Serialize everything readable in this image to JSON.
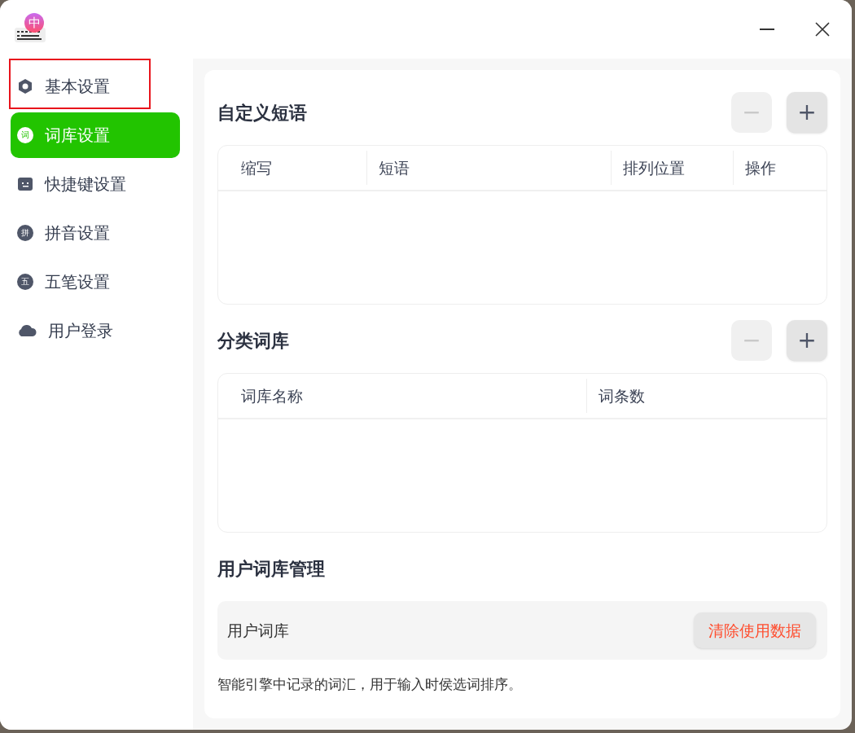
{
  "app_icon": {
    "glyph": "中"
  },
  "sidebar": {
    "items": [
      {
        "label": "基本设置",
        "kind": "hexagon",
        "selected": false,
        "annotated": true
      },
      {
        "label": "词库设置",
        "kind": "badge",
        "badge": "词",
        "selected": true,
        "annotated": false
      },
      {
        "label": "快捷键设置",
        "kind": "keyboard",
        "selected": false,
        "annotated": false
      },
      {
        "label": "拼音设置",
        "kind": "badge",
        "badge": "拼",
        "selected": false,
        "annotated": false
      },
      {
        "label": "五笔设置",
        "kind": "badge",
        "badge": "五",
        "selected": false,
        "annotated": false
      },
      {
        "label": "用户登录",
        "kind": "cloud",
        "selected": false,
        "annotated": false
      }
    ]
  },
  "sections": [
    {
      "kind": "table",
      "title": "自定义短语",
      "remove_button": {
        "label": "−",
        "disabled": true
      },
      "add_button": {
        "label": "+",
        "disabled": false
      },
      "columns": [
        "缩写",
        "短语",
        "排列位置",
        "操作"
      ]
    },
    {
      "kind": "table",
      "title": "分类词库",
      "remove_button": {
        "label": "−",
        "disabled": true
      },
      "add_button": {
        "label": "+",
        "disabled": false
      },
      "columns": [
        "词库名称",
        "词条数"
      ]
    },
    {
      "kind": "manage",
      "title": "用户词库管理",
      "row_label": "用户词库",
      "action": "清除使用数据",
      "note": "智能引擎中记录的词汇，用于输入时侯选词排序。"
    }
  ]
}
